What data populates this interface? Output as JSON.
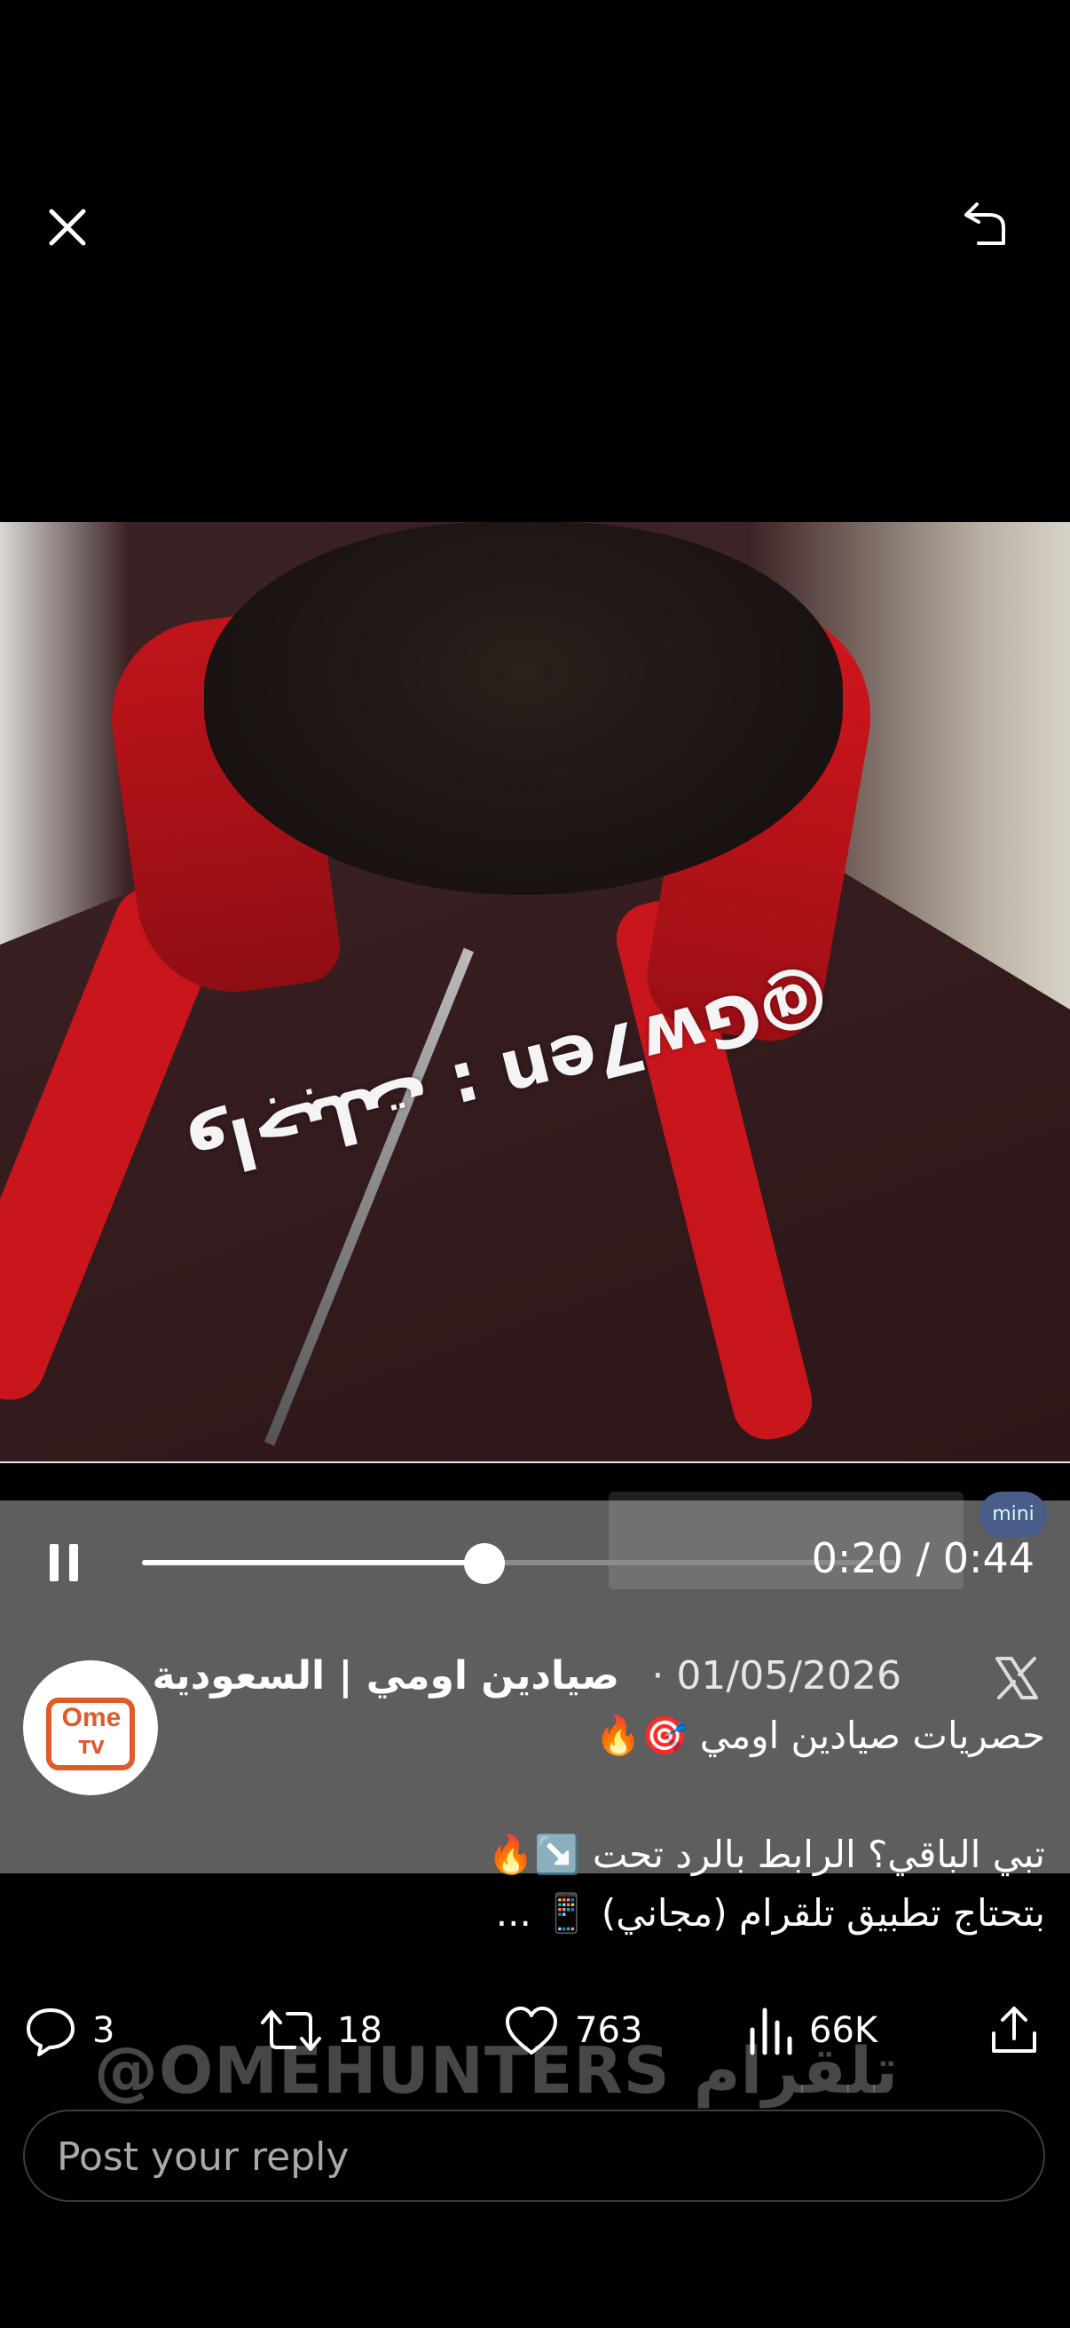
{
  "video": {
    "watermark_text": "@Gw7en : واجبلت"
  },
  "player": {
    "time_current": "0:20",
    "time_separator": " / ",
    "time_total": "0:44",
    "progress_fraction": 0.4545
  },
  "tweet": {
    "author_name": "صيادين اومي | السعودية",
    "date": "· 01/05/2026",
    "avatar_text_top": "Ome",
    "avatar_text_bottom": "TV",
    "text_line1": "حصريات صيادين اومي 🎯🔥",
    "text_line2": "تبي الباقي؟ الرابط بالرد تحت ↘️🔥",
    "text_line3": "بتحتاج تطبيق تلقرام (مجاني) 📱 ..."
  },
  "actions": {
    "replies": "3",
    "retweets": "18",
    "likes": "763",
    "views": "66K"
  },
  "overlay_watermark": "@OMEHUNTERS تلقرام",
  "reply": {
    "placeholder": "Post your reply"
  },
  "ghost": {
    "badge": "mini"
  },
  "icons": {
    "close": "close-icon",
    "rotate": "rotate-icon",
    "pause": "pause-icon",
    "x": "x-logo-icon",
    "reply": "reply-icon",
    "retweet": "retweet-icon",
    "like": "heart-icon",
    "views": "views-icon",
    "share": "share-icon"
  },
  "colors": {
    "overlay_gray": "#5e5e5e",
    "background": "#000000",
    "accent_tv": "#e05a2a"
  }
}
